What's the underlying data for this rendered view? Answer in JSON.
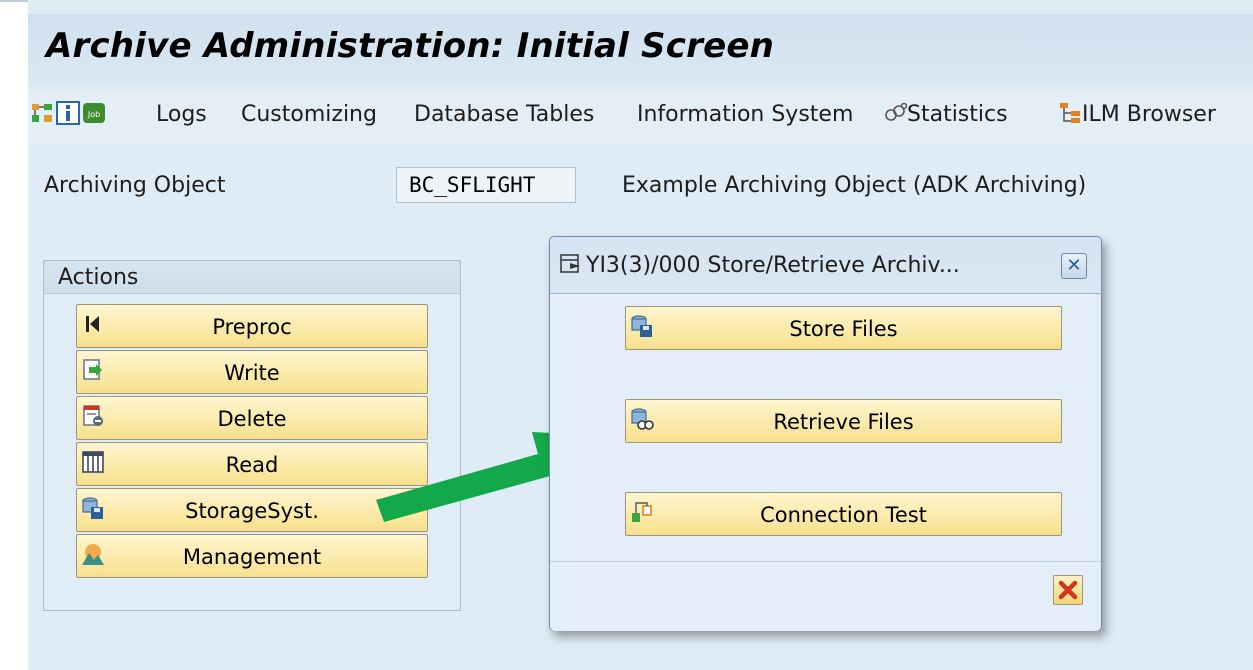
{
  "header": {
    "title": "Archive Administration: Initial Screen"
  },
  "toolbar": {
    "items": [
      {
        "label": "Logs"
      },
      {
        "label": "Customizing"
      },
      {
        "label": "Database Tables"
      },
      {
        "label": "Information System"
      },
      {
        "label": "Statistics"
      },
      {
        "label": "ILM Browser"
      }
    ],
    "icons": [
      "hierarchy-icon",
      "info-icon",
      "job-icon",
      "statistics-icon",
      "ilm-browser-icon"
    ],
    "job_icon_text": "Job"
  },
  "archiving_object": {
    "label": "Archiving Object",
    "value": "BC_SFLIGHT",
    "description": "Example Archiving Object (ADK Archiving)"
  },
  "actions": {
    "title": "Actions",
    "buttons": [
      {
        "label": "Preproc",
        "icon": "first-page-icon"
      },
      {
        "label": "Write",
        "icon": "write-icon"
      },
      {
        "label": "Delete",
        "icon": "delete-icon"
      },
      {
        "label": "Read",
        "icon": "read-icon"
      },
      {
        "label": "StorageSyst.",
        "icon": "storage-icon"
      },
      {
        "label": "Management",
        "icon": "management-icon"
      }
    ]
  },
  "dialog": {
    "title": "YI3(3)/000 Store/Retrieve Archiv...",
    "close_label": "✕",
    "buttons": [
      {
        "label": "Store Files",
        "icon": "store-files-icon"
      },
      {
        "label": "Retrieve Files",
        "icon": "retrieve-files-icon"
      },
      {
        "label": "Connection Test",
        "icon": "connection-test-icon"
      }
    ],
    "cancel_icon": "cancel-icon"
  },
  "colors": {
    "button_fill": "#f7e08c",
    "screen_bg": "#dfebf5",
    "arrow": "#13a84a",
    "cancel_red": "#d0361b"
  }
}
